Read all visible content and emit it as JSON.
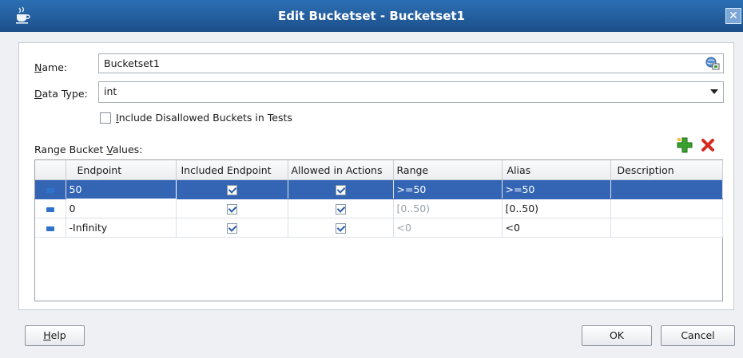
{
  "window": {
    "title": "Edit Bucketset - Bucketset1",
    "close_glyph": "✕"
  },
  "form": {
    "name_label_u": "N",
    "name_label_rest": "ame:",
    "name_value": "Bucketset1",
    "datatype_label_u": "D",
    "datatype_label_rest": "ata Type:",
    "datatype_value": "int",
    "include_u": "I",
    "include_rest": "nclude Disallowed Buckets in Tests",
    "range_label_prefix": "Range Bucket ",
    "range_label_u": "V",
    "range_label_rest": "alues:"
  },
  "table": {
    "columns": [
      "",
      "Endpoint",
      "Included Endpoint",
      "Allowed in Actions",
      "Range",
      "Alias",
      "Description"
    ],
    "rows": [
      {
        "endpoint": "50",
        "range": ">=50",
        "alias": ">=50",
        "description": "",
        "selected": true
      },
      {
        "endpoint": "0",
        "range": "[0..50)",
        "alias": "[0..50)",
        "description": "",
        "selected": false
      },
      {
        "endpoint": "-Infinity",
        "range": "<0",
        "alias": "<0",
        "description": "",
        "selected": false
      }
    ]
  },
  "buttons": {
    "help_u": "H",
    "help_rest": "elp",
    "ok": "OK",
    "cancel": "Cancel"
  },
  "icons": {
    "app": "java-cup-icon",
    "name_field": "translate-globe-icon",
    "add": "green-plus-icon",
    "delete": "red-x-icon"
  },
  "colors": {
    "titlebar": "#1d4f8a",
    "selection": "#3465b5",
    "add": "#3aa32f",
    "delete": "#d52b1e"
  }
}
